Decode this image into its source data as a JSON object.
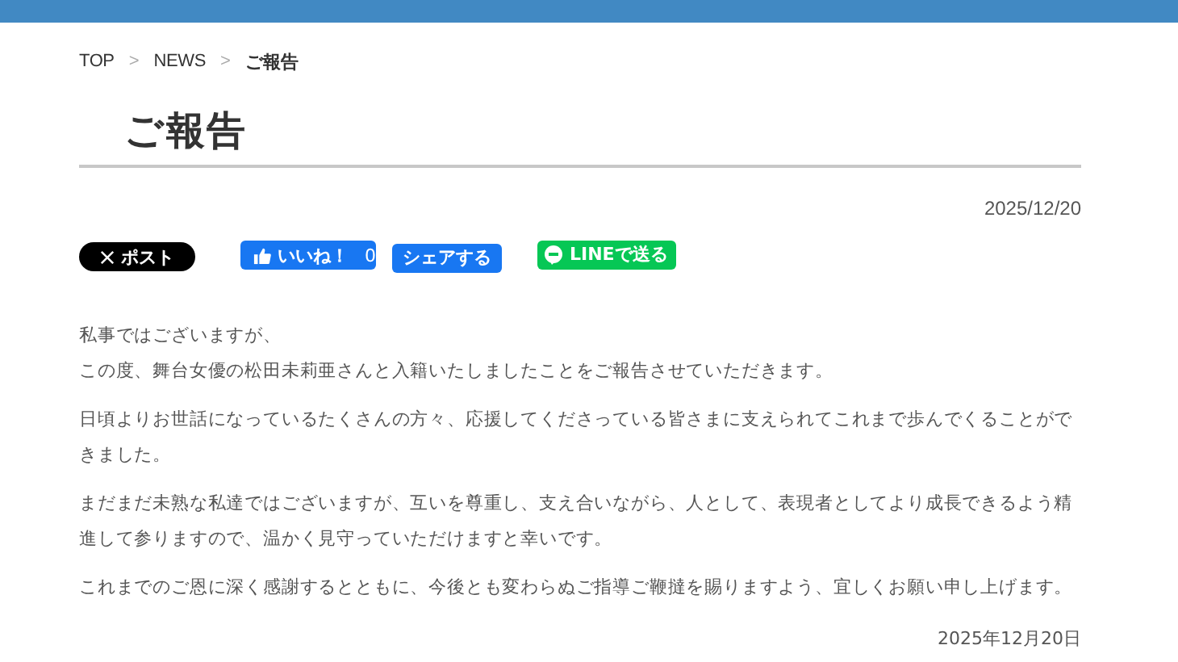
{
  "breadcrumb": [
    {
      "label": "TOP",
      "current": false
    },
    {
      "label": "NEWS",
      "current": false
    },
    {
      "label": "ご報告",
      "current": true
    }
  ],
  "breadcrumb_separator": ">",
  "title": "ご報告",
  "date": "2025/12/20",
  "share_buttons": [
    {
      "kind": "x",
      "label": "ポスト"
    },
    {
      "kind": "like",
      "label": "いいね！",
      "count": "0"
    },
    {
      "kind": "share",
      "label": "シェアする"
    },
    {
      "kind": "line",
      "label": "LINEで送る"
    }
  ],
  "paragraphs": [
    [
      "私事ではございますが、",
      "この度、舞台女優の松田未莉亜さんと入籍いたしましたことをご報告させていただきます。"
    ],
    "日頃よりお世話になっているたくさんの方々、応援してくださっている皆さまに支えられてこれまで歩んでくることができました。",
    "まだまだ未熟な私達ではございますが、互いを尊重し、支え合いながら、人として、表現者としてより成長できるよう精進して参りますので、温かく見守っていただけますと幸いです。",
    "これまでのご恩に深く感謝するとともに、今後とも変わらぬご指導ご鞭撻を賜りますよう、宜しくお願い申し上げます。"
  ],
  "signature_date": "2025年12月20日"
}
